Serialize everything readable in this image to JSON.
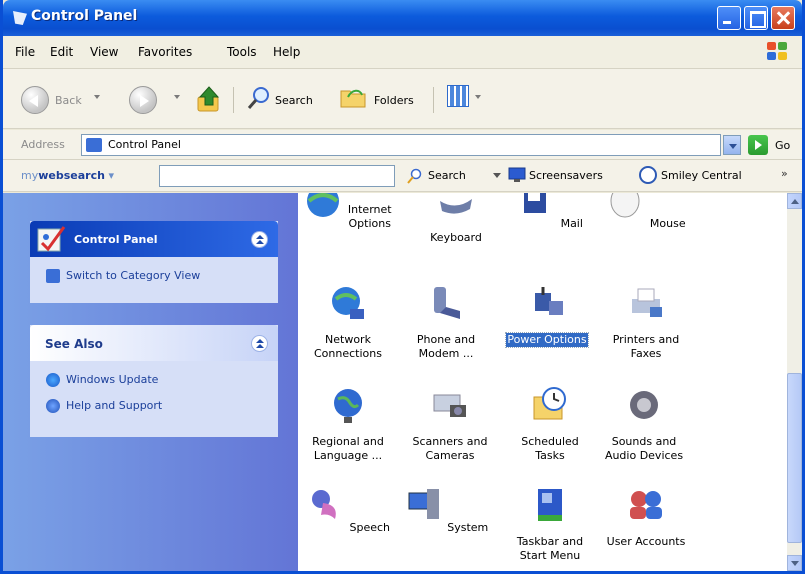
{
  "window": {
    "title": "Control Panel"
  },
  "menu": [
    "File",
    "Edit",
    "View",
    "Favorites",
    "Tools",
    "Help"
  ],
  "toolbar": {
    "back_label": "Back",
    "search_label": "Search",
    "folders_label": "Folders"
  },
  "address": {
    "label": "Address",
    "value": "Control Panel",
    "go_label": "Go"
  },
  "websearch": {
    "brand_prefix": "my",
    "brand_main": "websearch",
    "search_label": "Search",
    "screensavers_label": "Screensavers",
    "smiley_label": "Smiley Central",
    "more_label": "»"
  },
  "left_pane": {
    "control_panel": {
      "title": "Control Panel",
      "switch_label": "Switch to Category View"
    },
    "see_also": {
      "title": "See Also",
      "links": [
        "Windows Update",
        "Help and Support"
      ]
    }
  },
  "items": [
    {
      "name": "Internet Options",
      "line1": "Internet",
      "line2": "Options",
      "icon": "internet-options-icon",
      "selected": false
    },
    {
      "name": "Keyboard",
      "line1": "Keyboard",
      "line2": "",
      "icon": "keyboard-icon",
      "selected": false
    },
    {
      "name": "Mail",
      "line1": "Mail",
      "line2": "",
      "icon": "mail-icon",
      "selected": false
    },
    {
      "name": "Mouse",
      "line1": "Mouse",
      "line2": "",
      "icon": "mouse-icon",
      "selected": false
    },
    {
      "name": "Network Connections",
      "line1": "Network",
      "line2": "Connections",
      "icon": "network-icon",
      "selected": false
    },
    {
      "name": "Phone and Modem",
      "line1": "Phone and",
      "line2": "Modem ...",
      "icon": "phone-icon",
      "selected": false
    },
    {
      "name": "Power Options",
      "line1": "Power Options",
      "line2": "",
      "icon": "power-icon",
      "selected": true
    },
    {
      "name": "Printers and Faxes",
      "line1": "Printers and",
      "line2": "Faxes",
      "icon": "printer-icon",
      "selected": false
    },
    {
      "name": "Regional and Language",
      "line1": "Regional and",
      "line2": "Language ...",
      "icon": "globe-icon",
      "selected": false
    },
    {
      "name": "Scanners and Cameras",
      "line1": "Scanners and",
      "line2": "Cameras",
      "icon": "scanner-icon",
      "selected": false
    },
    {
      "name": "Scheduled Tasks",
      "line1": "Scheduled",
      "line2": "Tasks",
      "icon": "scheduled-tasks-icon",
      "selected": false
    },
    {
      "name": "Sounds and Audio Devices",
      "line1": "Sounds and",
      "line2": "Audio Devices",
      "icon": "speaker-icon",
      "selected": false
    },
    {
      "name": "Speech",
      "line1": "Speech",
      "line2": "",
      "icon": "speech-icon",
      "selected": false
    },
    {
      "name": "System",
      "line1": "System",
      "line2": "",
      "icon": "system-icon",
      "selected": false
    },
    {
      "name": "Taskbar and Start Menu",
      "line1": "Taskbar and",
      "line2": "Start Menu",
      "icon": "taskbar-icon",
      "selected": false
    },
    {
      "name": "User Accounts",
      "line1": "User Accounts",
      "line2": "",
      "icon": "user-accounts-icon",
      "selected": false
    }
  ],
  "colors": {
    "title_bar": "#0c5bdc",
    "selection": "#316ac5",
    "task_pane": "#6375d6"
  }
}
